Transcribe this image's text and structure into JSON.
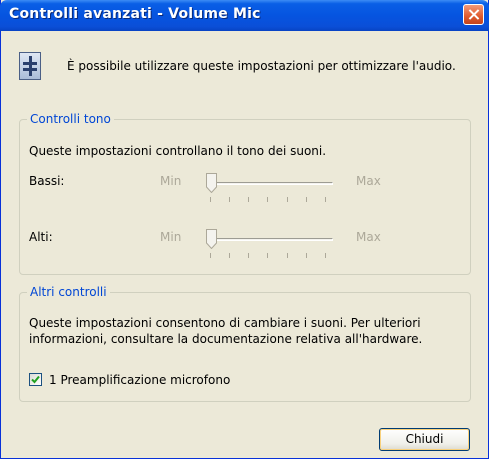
{
  "window": {
    "title": "Controlli avanzati - Volume Mic",
    "intro_text": "È possibile utilizzare queste impostazioni per ottimizzare l'audio."
  },
  "tone_controls": {
    "legend": "Controlli tono",
    "description": "Queste impostazioni controllano il tono dei suoni.",
    "sliders": [
      {
        "label": "Bassi:",
        "min_label": "Min",
        "max_label": "Max",
        "value_fraction": 0.0,
        "enabled": false
      },
      {
        "label": "Alti:",
        "min_label": "Min",
        "max_label": "Max",
        "value_fraction": 0.0,
        "enabled": false
      }
    ]
  },
  "other_controls": {
    "legend": "Altri controlli",
    "description_line1": "Queste impostazioni consentono di cambiare i suoni. Per ulteriori",
    "description_line2": "informazioni, consultare la documentazione relativa all'hardware.",
    "checkbox": {
      "label": "1  Preamplificazione microfono",
      "checked": true
    }
  },
  "buttons": {
    "close_label": "Chiudi"
  },
  "colors": {
    "titlebar": "#0654e0",
    "group_legend": "#0046d5",
    "disabled_text": "#aca899",
    "dialog_background": "#ece9d8"
  },
  "icons": [
    "close-icon",
    "info-icon",
    "slider-thumb-icon",
    "checkmark-icon"
  ]
}
